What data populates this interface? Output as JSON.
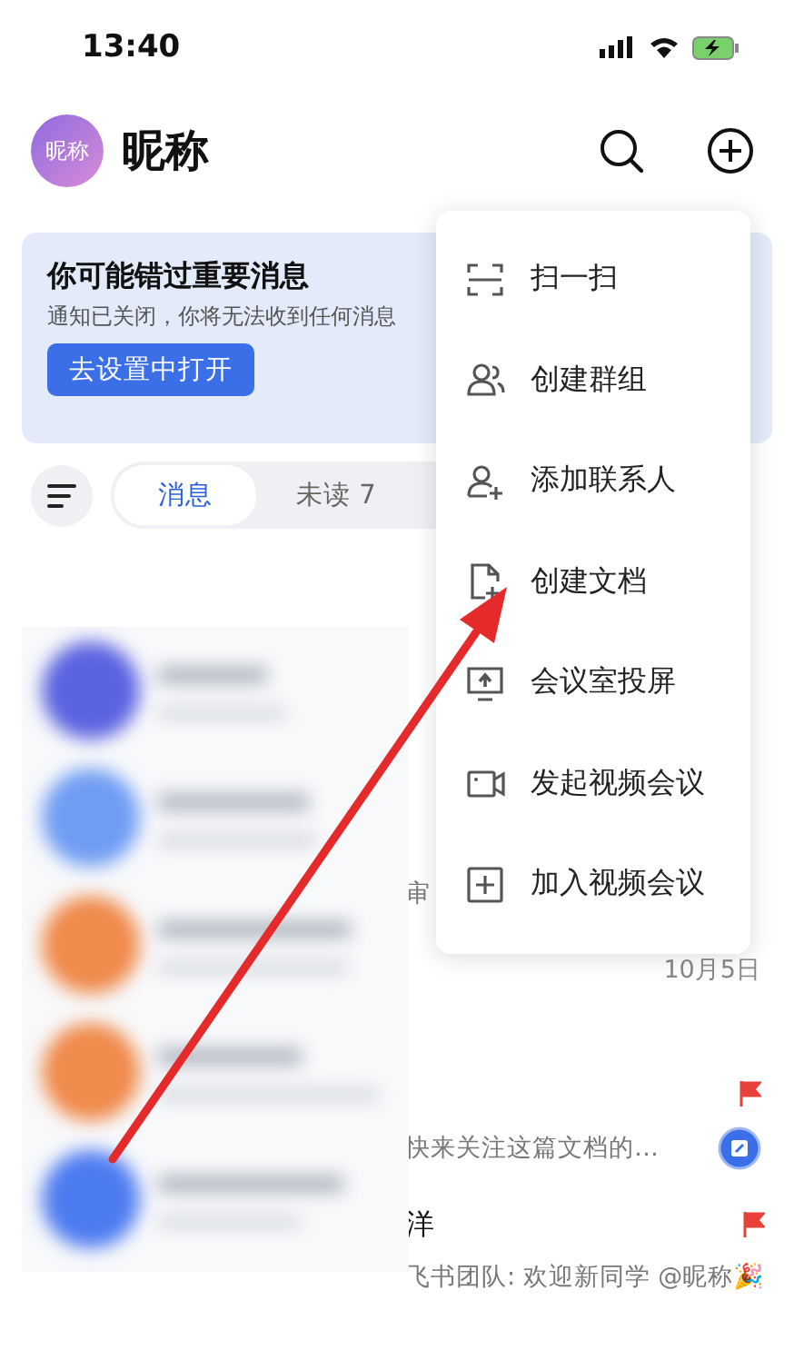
{
  "status_bar": {
    "time": "13:40"
  },
  "header": {
    "avatar_text": "昵称",
    "title": "昵称"
  },
  "banner": {
    "title": "你可能错过重要消息",
    "text": "通知已关闭，你将无法收到任何消息",
    "button": "去设置中打开"
  },
  "tabs": [
    {
      "label": "消息",
      "selected": true
    },
    {
      "label": "未读 7",
      "selected": false
    }
  ],
  "chats": [
    {
      "fragment": "审"
    },
    {
      "time": "10月5日"
    },
    {
      "flagged": true,
      "fragment": "快来关注这篇文档的…",
      "badge": true
    },
    {
      "flagged": true,
      "title": "洋",
      "fragment": "飞书团队: 欢迎新同学 @昵称🎉"
    }
  ],
  "menu": [
    {
      "label": "扫一扫"
    },
    {
      "label": "创建群组"
    },
    {
      "label": "添加联系人"
    },
    {
      "label": "创建文档"
    },
    {
      "label": "会议室投屏"
    },
    {
      "label": "发起视频会议"
    },
    {
      "label": "加入视频会议"
    }
  ]
}
